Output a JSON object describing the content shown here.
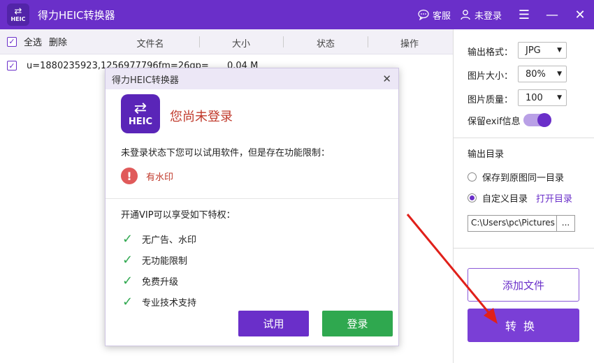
{
  "titlebar": {
    "logo_text": "HEIC",
    "title": "得力HEIC转换器",
    "service_label": "客服",
    "user_label": "未登录"
  },
  "list": {
    "select_all": "全选",
    "delete": "删除",
    "columns": [
      "文件名",
      "大小",
      "状态",
      "操作"
    ],
    "rows": [
      {
        "name": "u=1880235923,1256977796fm=26gp=",
        "size": "0.04 M"
      }
    ]
  },
  "settings": {
    "format_label": "输出格式：",
    "format_value": "JPG",
    "size_label": "图片大小：",
    "size_value": "80%",
    "quality_label": "图片质量：",
    "quality_value": "100",
    "exif_label": "保留exif信息",
    "exif_on": true,
    "output_dir_label": "输出目录",
    "same_dir_label": "保存到原图同一目录",
    "custom_dir_label": "自定义目录",
    "open_dir_label": "打开目录",
    "path_value": "C:\\Users\\pc\\Pictures",
    "browse_label": "...",
    "add_file_label": "添加文件",
    "convert_label": "转换"
  },
  "modal": {
    "title": "得力HEIC转换器",
    "logo_text": "HEIC",
    "heading": "您尚未登录",
    "limit_text": "未登录状态下您可以试用软件，但是存在功能限制：",
    "warning": "有水印",
    "vip_title": "开通VIP可以享受如下特权：",
    "privileges": [
      "无广告、水印",
      "无功能限制",
      "免费升级",
      "专业技术支持"
    ],
    "try_label": "试用",
    "login_label": "登录"
  },
  "colors": {
    "brand": "#6a2fc9",
    "success": "#2fa84f",
    "danger": "#c0392b"
  }
}
